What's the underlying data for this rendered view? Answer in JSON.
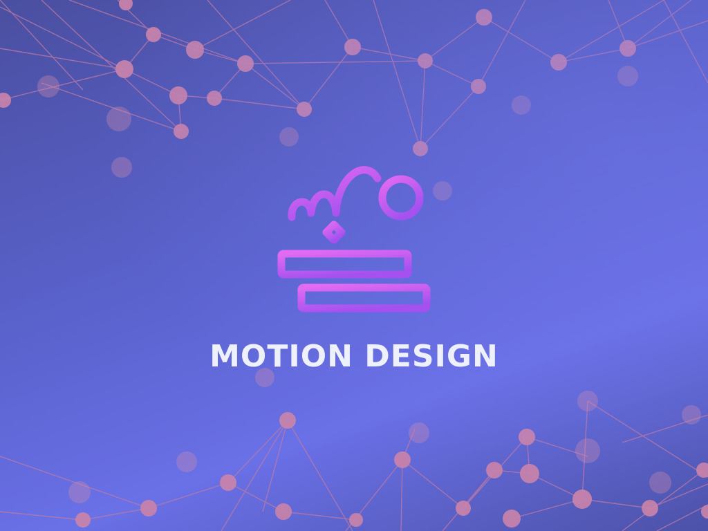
{
  "banner": {
    "title": "MOTION DESIGN",
    "logo_icon": "motion-design-icon"
  },
  "colors": {
    "background_dark": "#4a4fa0",
    "background_light": "#6a70e6",
    "network_node": "#c880a8",
    "network_line": "#c07aa6",
    "icon_gradient_start": "#d35cf5",
    "icon_gradient_end": "#a64ff0",
    "title": "#eef0fb"
  }
}
